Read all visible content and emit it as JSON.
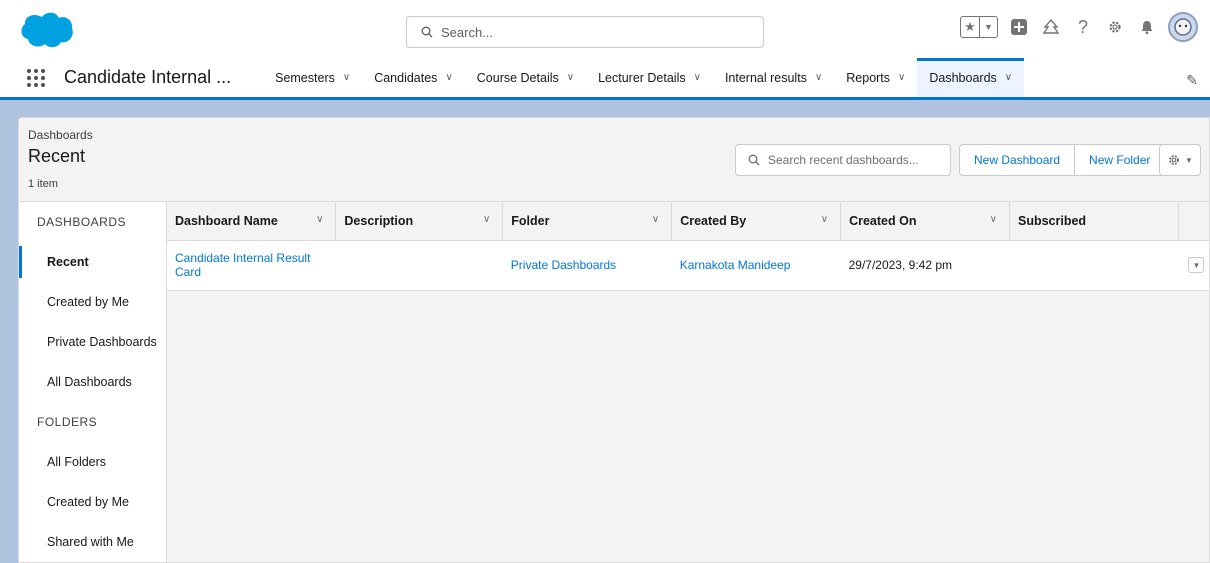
{
  "header": {
    "search_placeholder": "Search...",
    "utility_icons": [
      "star-icon",
      "chevron-down-icon",
      "add-icon",
      "trailhead-icon",
      "help-icon",
      "setup-gear-icon",
      "bell-icon",
      "avatar"
    ]
  },
  "nav": {
    "app_name": "Candidate Internal ...",
    "items": [
      {
        "label": "Semesters"
      },
      {
        "label": "Candidates"
      },
      {
        "label": "Course Details"
      },
      {
        "label": "Lecturer Details"
      },
      {
        "label": "Internal results"
      },
      {
        "label": "Reports"
      },
      {
        "label": "Dashboards",
        "active": true
      }
    ]
  },
  "list_header": {
    "eyebrow": "Dashboards",
    "title": "Recent",
    "count": "1 item",
    "search_placeholder": "Search recent dashboards...",
    "new_dashboard_label": "New Dashboard",
    "new_folder_label": "New Folder"
  },
  "sidebar": {
    "dashboards_heading": "DASHBOARDS",
    "dashboards_items": [
      "Recent",
      "Created by Me",
      "Private Dashboards",
      "All Dashboards"
    ],
    "folders_heading": "FOLDERS",
    "folders_items": [
      "All Folders",
      "Created by Me",
      "Shared with Me"
    ]
  },
  "table": {
    "columns": [
      "Dashboard Name",
      "Description",
      "Folder",
      "Created By",
      "Created On",
      "Subscribed"
    ],
    "rows": [
      {
        "name": "Candidate Internal Result Card",
        "description": "",
        "folder": "Private Dashboards",
        "created_by": "Karnakota Manideep",
        "created_on": "29/7/2023, 9:42 pm",
        "subscribed": ""
      }
    ]
  },
  "colors": {
    "brand": "#0176d3",
    "background": "#b0c4df"
  }
}
